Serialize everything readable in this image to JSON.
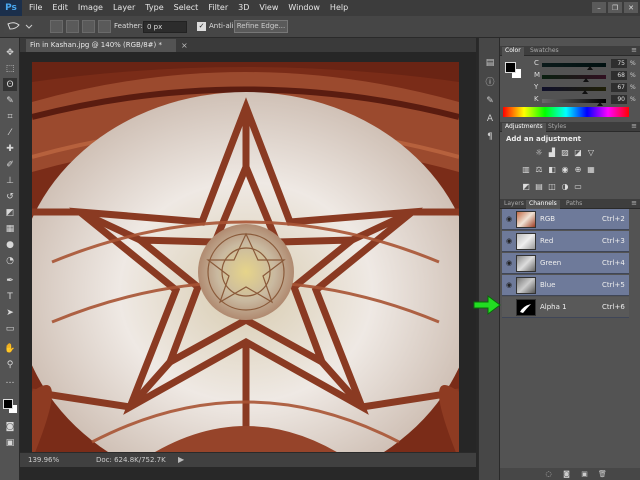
{
  "app": {
    "logo": "Ps"
  },
  "menu": [
    "File",
    "Edit",
    "Image",
    "Layer",
    "Type",
    "Select",
    "Filter",
    "3D",
    "View",
    "Window",
    "Help"
  ],
  "window_controls": {
    "minimize": "–",
    "restore": "❐",
    "close": "✕"
  },
  "options_bar": {
    "feather_label": "Feather:",
    "feather_value": "0 px",
    "antialias_label": "Anti-alias",
    "antialias_checked": true,
    "refine_edge_label": "Refine Edge..."
  },
  "document": {
    "tab_title": "Fin in Kashan.jpg @ 140% (RGB/8#) *",
    "close": "×"
  },
  "status": {
    "zoom": "139.96%",
    "doc_size": "Doc: 624.8K/752.7K",
    "arrow": "▶"
  },
  "color_panel": {
    "tabs": [
      "Color",
      "Swatches"
    ],
    "sliders": [
      {
        "label": "C",
        "value": "75",
        "pct": "%",
        "level": 0.75
      },
      {
        "label": "M",
        "value": "68",
        "pct": "%",
        "level": 0.68
      },
      {
        "label": "Y",
        "value": "67",
        "pct": "%",
        "level": 0.67
      },
      {
        "label": "K",
        "value": "90",
        "pct": "%",
        "level": 0.9
      }
    ]
  },
  "adjustments_panel": {
    "tabs": [
      "Adjustments",
      "Styles"
    ],
    "heading": "Add an adjustment"
  },
  "channels_panel": {
    "tabs": [
      "Layers",
      "Channels",
      "Paths"
    ],
    "channels": [
      {
        "name": "RGB",
        "shortcut": "Ctrl+2"
      },
      {
        "name": "Red",
        "shortcut": "Ctrl+3"
      },
      {
        "name": "Green",
        "shortcut": "Ctrl+4"
      },
      {
        "name": "Blue",
        "shortcut": "Ctrl+5"
      },
      {
        "name": "Alpha 1",
        "shortcut": "Ctrl+6"
      }
    ]
  },
  "colors": {
    "accent_highlight": "#6e7a9a",
    "annotation_arrow": "#22dd22"
  }
}
